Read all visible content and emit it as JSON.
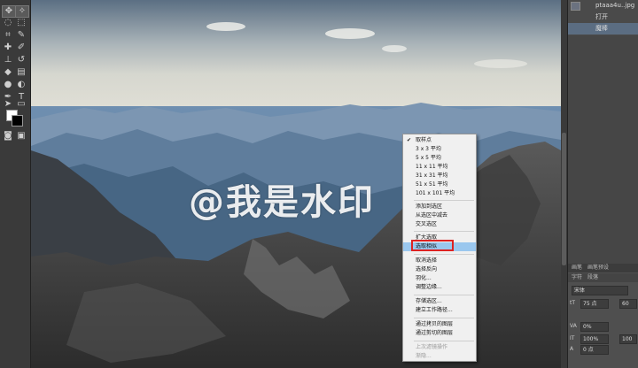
{
  "history_panel": {
    "items": [
      {
        "label": "ptaaa4u..jpg",
        "selected": false
      },
      {
        "label": "打开",
        "selected": false
      },
      {
        "label": "魔棒",
        "selected": true
      }
    ]
  },
  "watermark_text": "@我是水印",
  "context_menu": {
    "items": [
      {
        "label": "取样点",
        "checked": true,
        "disabled": false,
        "highlighted": false
      },
      {
        "label": "3 x 3 平均",
        "checked": false,
        "disabled": false,
        "highlighted": false
      },
      {
        "label": "5 x 5 平均",
        "checked": false,
        "disabled": false,
        "highlighted": false
      },
      {
        "label": "11 x 11 平均",
        "checked": false,
        "disabled": false,
        "highlighted": false
      },
      {
        "label": "31 x 31 平均",
        "checked": false,
        "disabled": false,
        "highlighted": false
      },
      {
        "label": "51 x 51 平均",
        "checked": false,
        "disabled": false,
        "highlighted": false
      },
      {
        "label": "101 x 101 平均",
        "checked": false,
        "disabled": false,
        "highlighted": false
      },
      {
        "label": "添加到选区",
        "checked": false,
        "disabled": false,
        "highlighted": false
      },
      {
        "label": "从选区中减去",
        "checked": false,
        "disabled": false,
        "highlighted": false
      },
      {
        "label": "交叉选区",
        "checked": false,
        "disabled": false,
        "highlighted": false
      },
      {
        "label": "扩大选取",
        "checked": false,
        "disabled": false,
        "highlighted": false
      },
      {
        "label": "选取相似",
        "checked": false,
        "disabled": false,
        "highlighted": true
      },
      {
        "label": "取消选择",
        "checked": false,
        "disabled": false,
        "highlighted": false
      },
      {
        "label": "选择反向",
        "checked": false,
        "disabled": false,
        "highlighted": false
      },
      {
        "label": "羽化...",
        "checked": false,
        "disabled": false,
        "highlighted": false
      },
      {
        "label": "调整边缘...",
        "checked": false,
        "disabled": false,
        "highlighted": false
      },
      {
        "label": "存储选区...",
        "checked": false,
        "disabled": false,
        "highlighted": false
      },
      {
        "label": "建立工作路径...",
        "checked": false,
        "disabled": false,
        "highlighted": false
      },
      {
        "label": "通过拷贝的图层",
        "checked": false,
        "disabled": false,
        "highlighted": false
      },
      {
        "label": "通过剪切的图层",
        "checked": false,
        "disabled": false,
        "highlighted": false
      },
      {
        "label": "上次滤镜操作",
        "checked": false,
        "disabled": true,
        "highlighted": false
      },
      {
        "label": "渐隐...",
        "checked": false,
        "disabled": true,
        "highlighted": false
      }
    ]
  },
  "character_panel": {
    "tabs": [
      "画笔",
      "画笔预设"
    ],
    "subtabs": [
      "字符",
      "段落"
    ],
    "font_family": "宋体",
    "font_size": "75 点",
    "leading": "60",
    "kerning": "0%",
    "scale_v": "100%",
    "tracking": "0 点",
    "scale_h": "100"
  },
  "colors": {
    "menu_bg": "#f0f0f0",
    "menu_highlight": "#9ac7ee",
    "highlight_outline": "#d22222",
    "panel_bg": "#4a4a4a",
    "toolbar_bg": "#3a3a3a"
  }
}
